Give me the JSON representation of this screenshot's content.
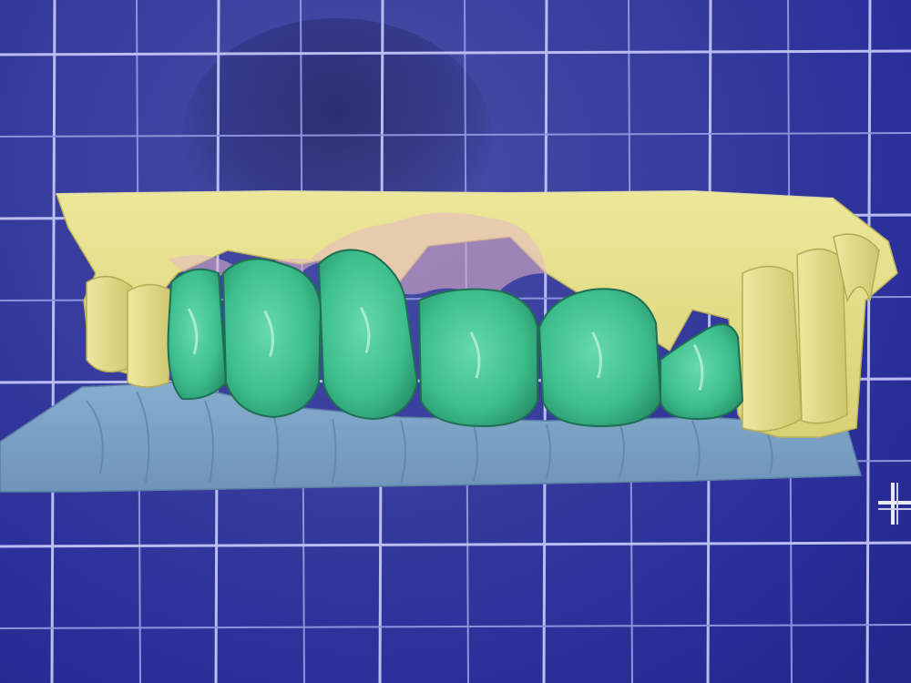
{
  "scene": {
    "description_icon": "dental-cad-3d-viewport",
    "colors": {
      "background": "#2b309a",
      "grid_major": "#b9bdf0",
      "grid_minor": "#8d92dc",
      "restoration_teeth": "#3fbf8f",
      "upper_model": "#e6df86",
      "lower_model": "#7fa6c8",
      "gingiva": "#e6b9c4"
    }
  },
  "teeth": {
    "restorations": [
      {
        "name": "crown-1"
      },
      {
        "name": "crown-2"
      },
      {
        "name": "crown-3"
      },
      {
        "name": "crown-4"
      },
      {
        "name": "crown-5"
      },
      {
        "name": "crown-6"
      }
    ]
  },
  "tools": {
    "move_icon": "crosshair-icon"
  }
}
